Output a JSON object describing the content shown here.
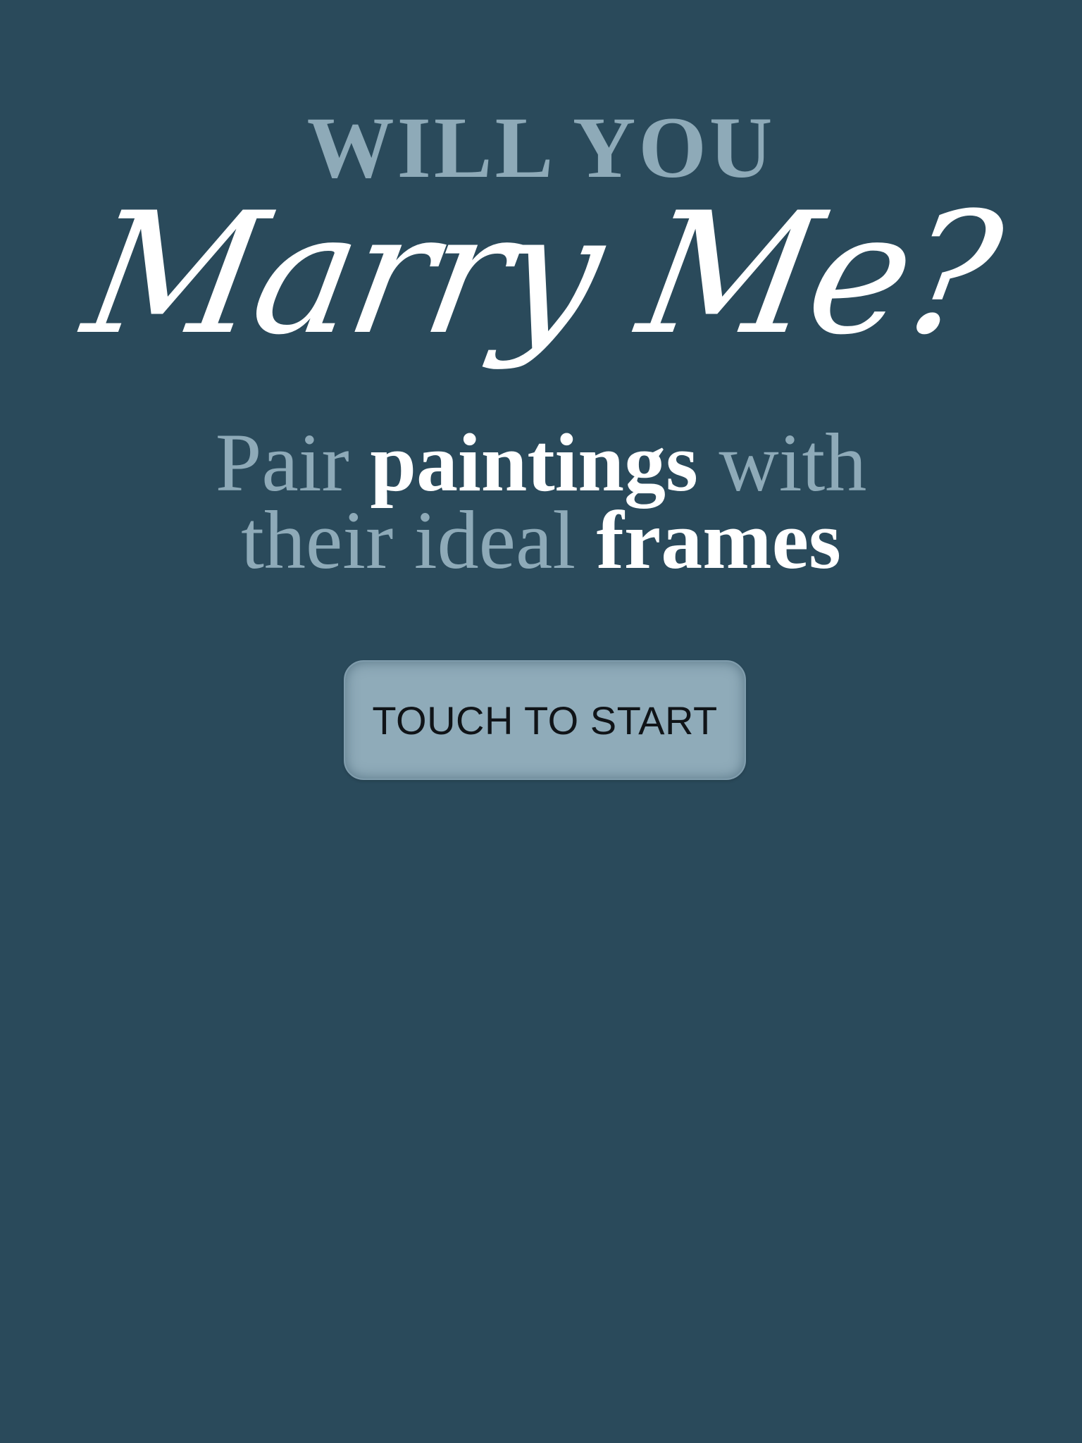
{
  "title": {
    "kicker": "WILL YOU",
    "script": "Marry Me?"
  },
  "tagline": {
    "line1_part1": "Pair ",
    "line1_part2": "paintings",
    "line1_part3": " with",
    "line2_part1": "their ideal ",
    "line2_part2": "frames"
  },
  "start_button": {
    "label": "TOUCH TO START"
  },
  "colors": {
    "background": "#2a4a5b",
    "muted_text": "#8eaab8",
    "highlight_text": "#ffffff",
    "button_fill": "#8fabb9",
    "button_text": "#101418"
  }
}
